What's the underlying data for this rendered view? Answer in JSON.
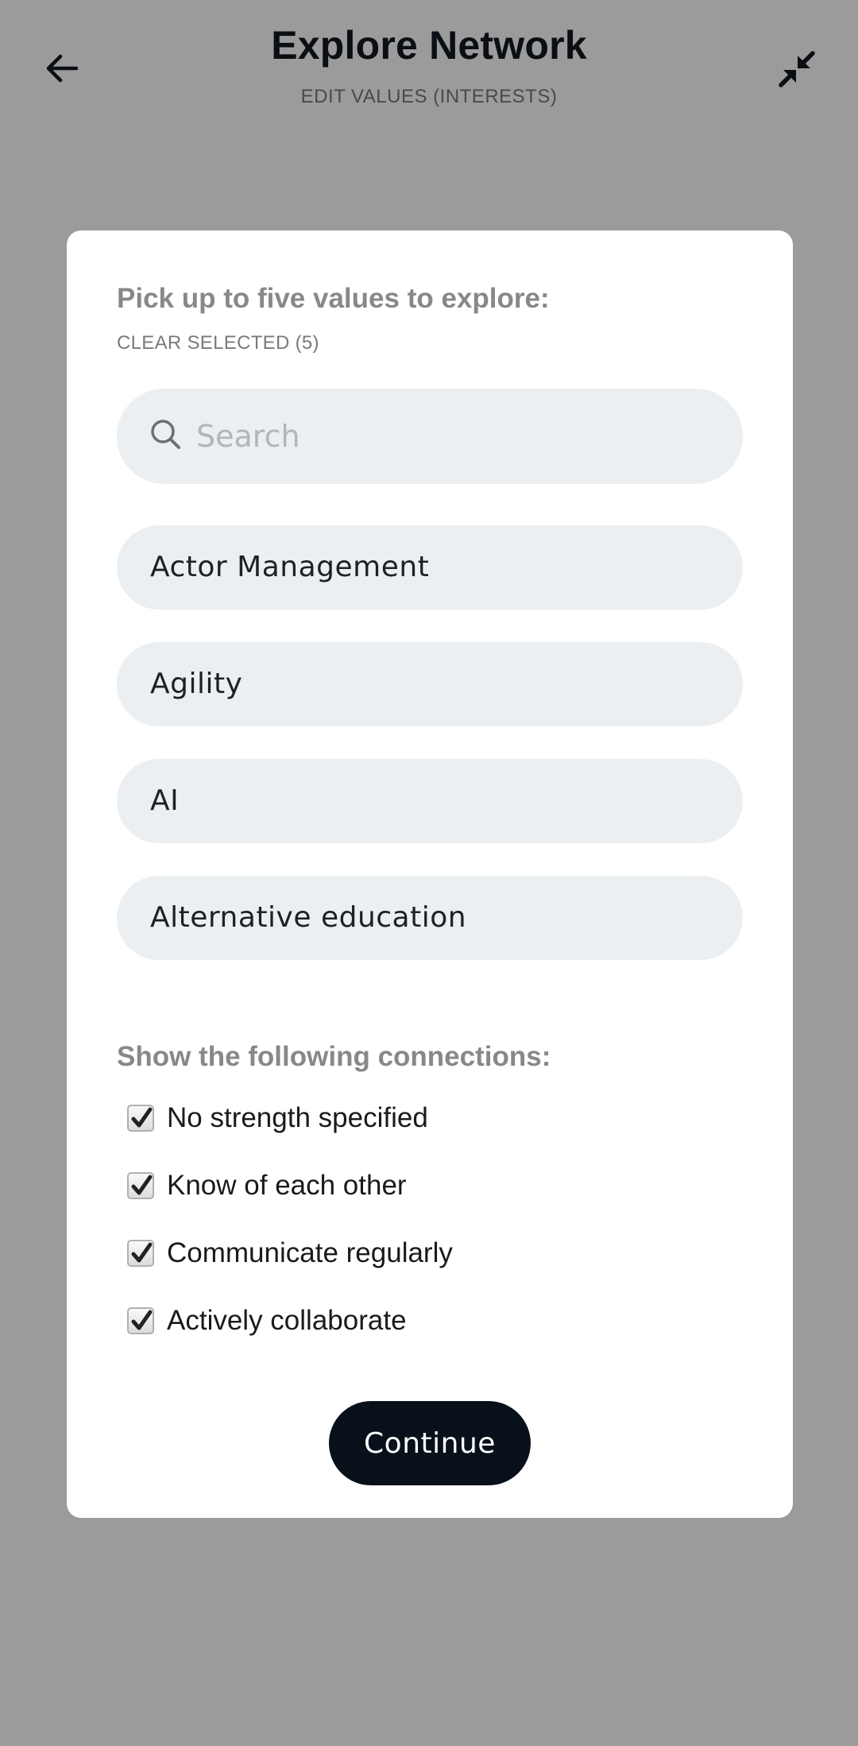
{
  "header": {
    "title": "Explore Network",
    "subtitle": "EDIT VALUES (INTERESTS)",
    "back_icon": "arrow-left-icon",
    "collapse_icon": "collapse-arrows-icon"
  },
  "modal": {
    "prompt": "Pick up to five values to explore:",
    "clear_label": "CLEAR SELECTED (5)",
    "search": {
      "placeholder": "Search",
      "value": ""
    },
    "options": [
      {
        "label": "Actor Management"
      },
      {
        "label": "Agility"
      },
      {
        "label": "AI"
      },
      {
        "label": "Alternative education"
      }
    ],
    "connections_heading": "Show the following connections:",
    "connections": [
      {
        "label": "No strength specified",
        "checked": true
      },
      {
        "label": "Know of each other",
        "checked": true
      },
      {
        "label": "Communicate regularly",
        "checked": true
      },
      {
        "label": "Actively collaborate",
        "checked": true
      }
    ],
    "continue_label": "Continue"
  },
  "colors": {
    "backdrop": "#9b9b9b",
    "card": "#ffffff",
    "pill": "#eceff1",
    "primary_button": "#08101a"
  }
}
